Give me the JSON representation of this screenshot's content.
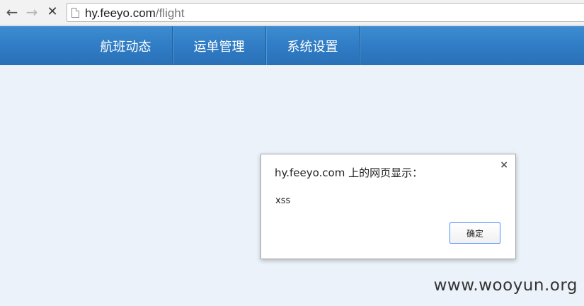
{
  "browser": {
    "url_host": "hy.feeyo.com",
    "url_path": "/flight",
    "icons": {
      "back": "back-arrow-icon",
      "forward": "forward-arrow-icon",
      "stop": "stop-loading-icon",
      "page": "page-icon"
    }
  },
  "site_nav": {
    "items": [
      {
        "label": "航班动态"
      },
      {
        "label": "运单管理"
      },
      {
        "label": "系统设置"
      }
    ],
    "colors": {
      "bar": "#2f7bc4"
    }
  },
  "dialog": {
    "title": "hy.feeyo.com 上的网页显示：",
    "message": "xss",
    "close_symbol": "×",
    "ok_label": "确定"
  },
  "watermark": "www.wooyun.org",
  "colors": {
    "page_background": "#ecf2fa",
    "button_border": "#4d90fe"
  }
}
